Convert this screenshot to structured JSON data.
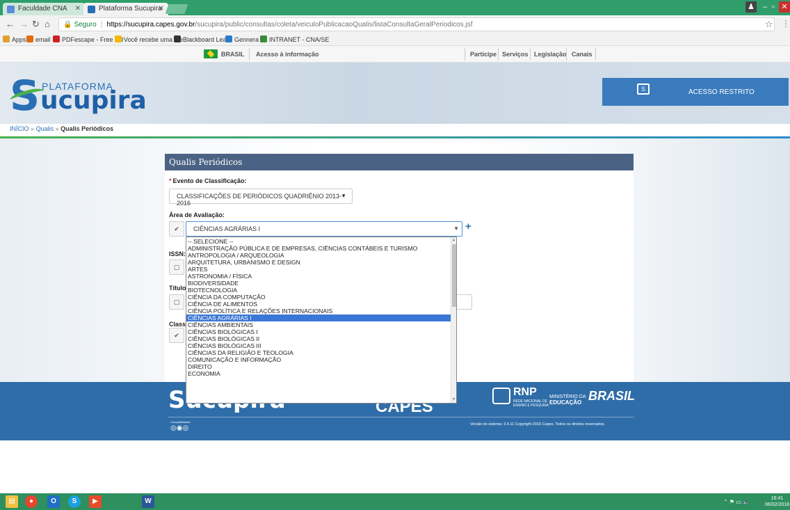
{
  "browser": {
    "tabs": [
      {
        "title": "Faculdade CNA"
      },
      {
        "title": "Plataforma Sucupira"
      }
    ],
    "url": {
      "secure_label": "Seguro",
      "host": "https://sucupira.capes.gov.br",
      "path": "/sucupira/public/consultas/coleta/veiculoPublicacaoQualis/listaConsultaGeralPeriodicos.jsf"
    },
    "bookmarks": [
      {
        "label": "Apps",
        "color": "#e0a030"
      },
      {
        "label": "email",
        "color": "#e06a10"
      },
      {
        "label": "PDFescape - Free PD",
        "color": "#c22"
      },
      {
        "label": "Você recebe uma me",
        "color": "#f2b700"
      },
      {
        "label": "Blackboard Learn",
        "color": "#333"
      },
      {
        "label": "Gennera",
        "color": "#2a7ad0"
      },
      {
        "label": "INTRANET - CNA/SE",
        "color": "#3a8a3a"
      }
    ]
  },
  "govbar": {
    "brasil": "BRASIL",
    "acesso": "Acesso à informação",
    "links": [
      "Participe",
      "Serviços",
      "Legislação",
      "Canais"
    ]
  },
  "header": {
    "logo_s": "S",
    "logo_plataforma": "PLATAFORMA",
    "logo_ucupira": "ucupira",
    "acesso_restrito": "ACESSO RESTRITO",
    "acesso_icon": "S"
  },
  "breadcrumb": {
    "inicio": "INÍCIO",
    "sep": "»",
    "qualis": "Qualis",
    "current": "Qualis Periódicos"
  },
  "form": {
    "title": "Qualis Periódicos",
    "evento_label": "Evento de Classificação:",
    "evento_required": "*",
    "evento_value": "CLASSIFICAÇÕES DE PERIÓDICOS QUADRIÊNIO 2013-2016",
    "area_label": "Área de Avaliação:",
    "area_value": "CIÊNCIAS AGRÁRIAS I",
    "issn_label": "ISSN:",
    "titulo_label": "Título",
    "class_label": "Class",
    "check_mark": "✔",
    "empty_box": "▢",
    "plus": "+",
    "caret": "▼"
  },
  "dropdown": {
    "options": [
      "-- SELECIONE --",
      "ADMINISTRAÇÃO PÚBLICA E DE EMPRESAS, CIÊNCIAS CONTÁBEIS E TURISMO",
      "ANTROPOLOGIA / ARQUEOLOGIA",
      "ARQUITETURA, URBANISMO E DESIGN",
      "ARTES",
      "ASTRONOMIA / FÍSICA",
      "BIODIVERSIDADE",
      "BIOTECNOLOGIA",
      "CIÊNCIA DA COMPUTAÇÃO",
      "CIÊNCIA DE ALIMENTOS",
      "CIÊNCIA POLÍTICA E RELAÇÕES INTERNACIONAIS",
      "CIÊNCIAS AGRÁRIAS I",
      "CIÊNCIAS AMBIENTAIS",
      "CIÊNCIAS BIOLÓGICAS I",
      "CIÊNCIAS BIOLÓGICAS II",
      "CIÊNCIAS BIOLÓGICAS III",
      "CIÊNCIAS DA RELIGIÃO E TEOLOGIA",
      "COMUNICAÇÃO E INFORMAÇÃO",
      "DIREITO",
      "ECONOMIA"
    ],
    "selected_index": 11
  },
  "footer": {
    "logo": "Sucupira",
    "capes": "CAPES",
    "rnp": "RNP",
    "rnp_sub": "REDE NACIONAL DE ENSINO E PESQUISA",
    "mec_line1": "MINISTÉRIO DA",
    "mec_line2": "EDUCAÇÃO",
    "brasil": "BRASIL",
    "compat": "Compatibilidade",
    "version": "Versão do sistema: 3.4.11    Copyright 2016 Capes. Todos os direitos reservados."
  },
  "taskbar": {
    "time": "16:41",
    "date": "06/02/2018"
  }
}
